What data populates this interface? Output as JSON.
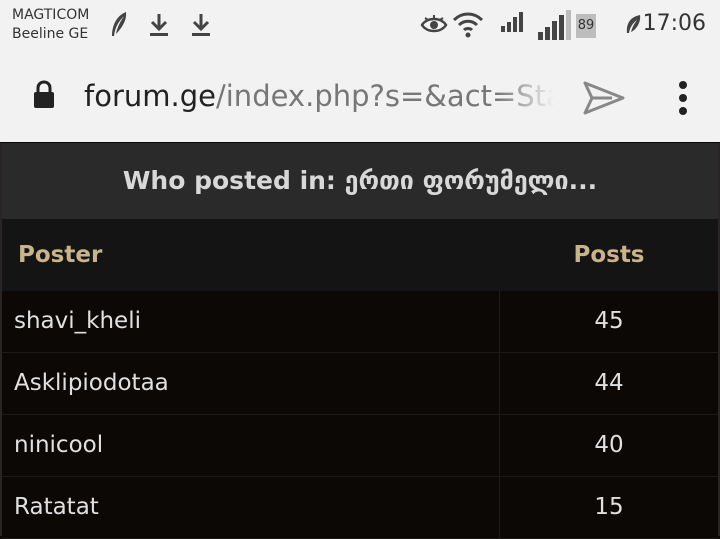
{
  "status": {
    "carrier1": "MAGTICOM",
    "carrier2": "Beeline GE",
    "battery": "89",
    "time": "17:06"
  },
  "browser": {
    "url_host": "forum.ge",
    "url_path": "/index.php?s=&act=Stat"
  },
  "page": {
    "title": "Who posted in: ერთი ფორუმელი...",
    "columns": {
      "poster": "Poster",
      "posts": "Posts"
    },
    "rows": [
      {
        "poster": "shavi_kheli",
        "posts": "45"
      },
      {
        "poster": "Asklipiodotaa",
        "posts": "44"
      },
      {
        "poster": "ninicool",
        "posts": "40"
      },
      {
        "poster": "Ratatat",
        "posts": "15"
      }
    ]
  }
}
